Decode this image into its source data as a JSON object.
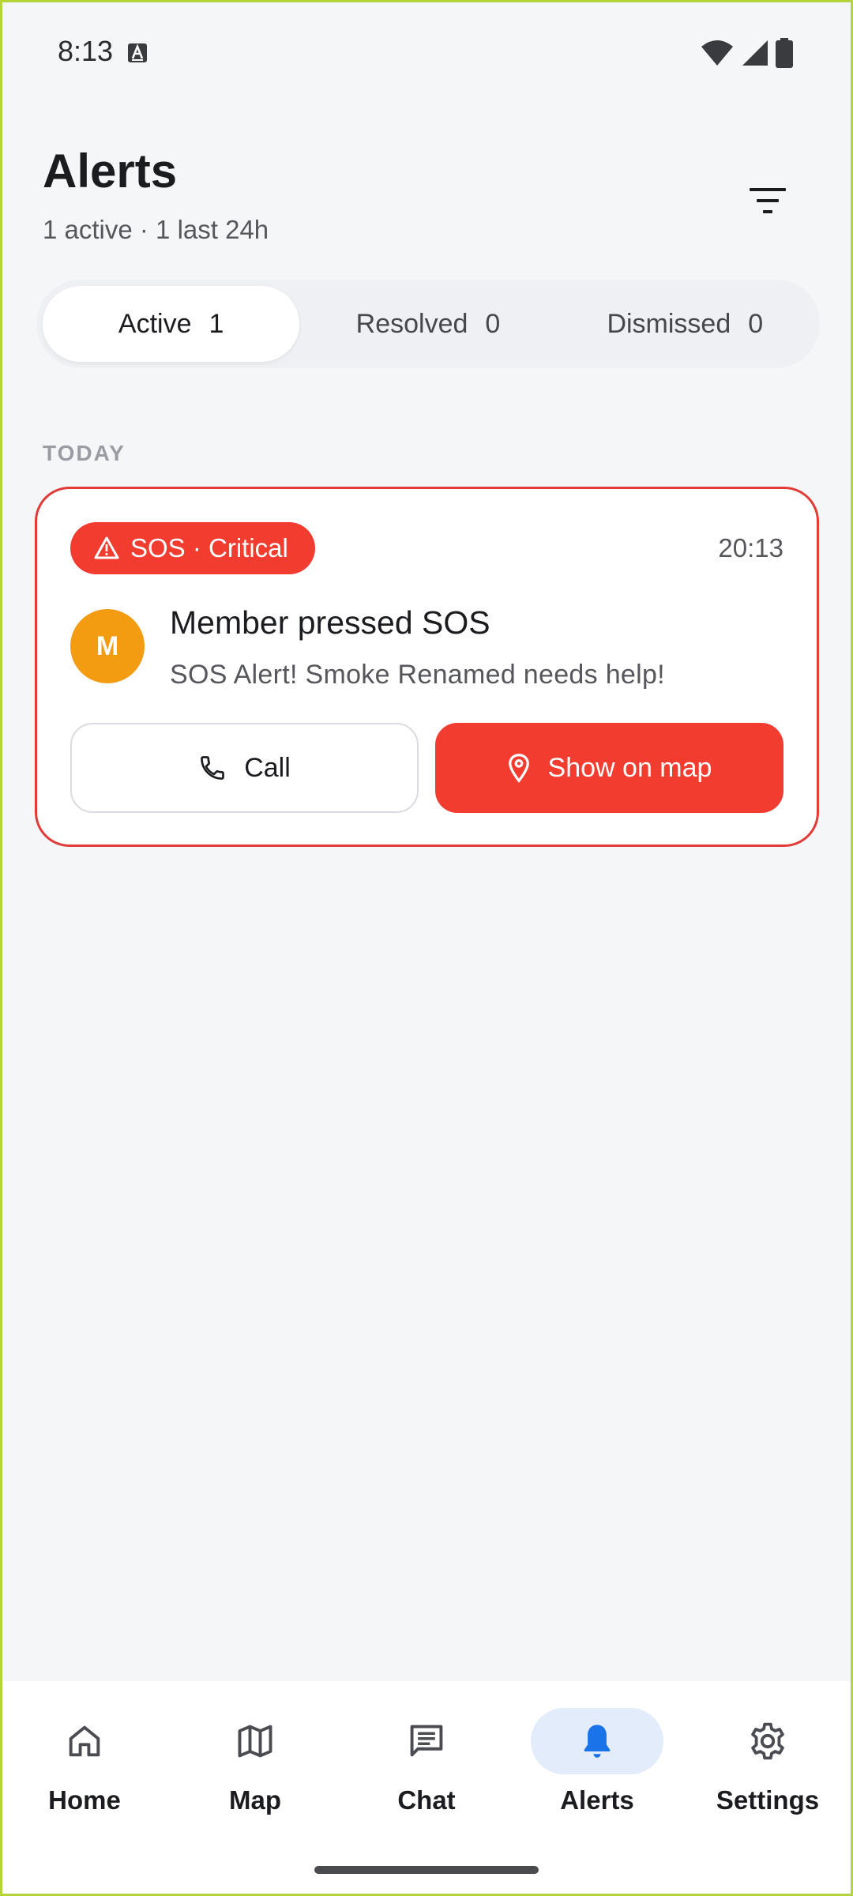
{
  "status_bar": {
    "time": "8:13",
    "icons": [
      "a-badge-icon",
      "wifi-icon",
      "signal-icon",
      "battery-icon"
    ]
  },
  "header": {
    "title": "Alerts",
    "subtitle": "1 active · 1 last 24h",
    "filter_icon": "filter-icon"
  },
  "tabs": [
    {
      "label": "Active",
      "count": "1",
      "selected": true
    },
    {
      "label": "Resolved",
      "count": "0",
      "selected": false
    },
    {
      "label": "Dismissed",
      "count": "0",
      "selected": false
    }
  ],
  "section": {
    "label": "TODAY"
  },
  "alert": {
    "badge": "SOS · Critical",
    "badge_icon": "warning-triangle-icon",
    "time": "20:13",
    "avatar_initial": "M",
    "title": "Member pressed SOS",
    "message": "SOS Alert! Smoke Renamed needs help!",
    "call_label": "Call",
    "call_icon": "phone-icon",
    "map_label": "Show on map",
    "map_icon": "location-pin-icon"
  },
  "bottom_nav": [
    {
      "label": "Home",
      "icon": "home-icon",
      "active": false
    },
    {
      "label": "Map",
      "icon": "map-icon",
      "active": false
    },
    {
      "label": "Chat",
      "icon": "chat-icon",
      "active": false
    },
    {
      "label": "Alerts",
      "icon": "bell-icon",
      "active": true
    },
    {
      "label": "Settings",
      "icon": "gear-icon",
      "active": false
    }
  ],
  "colors": {
    "accent_red": "#f23c30",
    "card_border": "#e23a36",
    "avatar": "#f39c12",
    "nav_active_bg": "#e3ecfb",
    "nav_active_icon": "#1a73e8",
    "background": "#f5f6f8"
  }
}
